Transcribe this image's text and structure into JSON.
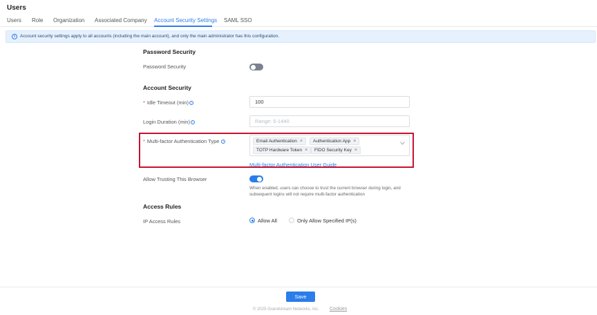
{
  "header": {
    "title": "Users"
  },
  "tabs": [
    {
      "label": "Users"
    },
    {
      "label": "Role"
    },
    {
      "label": "Organization"
    },
    {
      "label": "Associated Company"
    },
    {
      "label": "Account Security Settings"
    },
    {
      "label": "SAML SSO"
    }
  ],
  "active_tab": "Account Security Settings",
  "info_bar": {
    "text": "Account security settings apply to all accounts (including the main account), and only the main administrator has this configuration."
  },
  "password_security": {
    "section_title": "Password Security",
    "toggle_label": "Password Security",
    "enabled": false
  },
  "account_security": {
    "section_title": "Account Security",
    "idle_timeout": {
      "label": "Idle Timeout (min)",
      "value": "100"
    },
    "login_duration": {
      "label": "Login Duration (min)",
      "value": "",
      "placeholder": "Range: 5-1440"
    },
    "mfa": {
      "label": "Multi-factor Authentication Type",
      "selected": [
        "Email Authentication",
        "Authentication App",
        "TOTP Hardware Token",
        "FIDO Security Key"
      ],
      "guide_link": "Multi-factor Authentication User Guide"
    },
    "allow_trusting": {
      "label": "Allow Trusting This Browser",
      "enabled": true,
      "help_text": "When enabled, users can choose to trust the current browser during login, and subsequent logins will not require multi-factor authentication"
    }
  },
  "access_rules": {
    "section_title": "Access Rules",
    "ip_rules": {
      "label": "IP Access Rules",
      "options": [
        "Allow All",
        "Only Allow Specified IP(s)"
      ],
      "selected": "Allow All"
    }
  },
  "footer": {
    "save_label": "Save",
    "copyright": "© 2025 Grandstream Networks, Inc.",
    "cookies_label": "Cookies"
  },
  "colors": {
    "accent": "#2b7de9",
    "highlight_border": "#c8102e",
    "required": "#e53e3e",
    "info_bg": "#e6f1fd"
  },
  "icons": {
    "info": "info-circle-icon",
    "help": "help-circle-icon",
    "chip_close": "close-icon",
    "dropdown": "chevron-down-icon"
  }
}
